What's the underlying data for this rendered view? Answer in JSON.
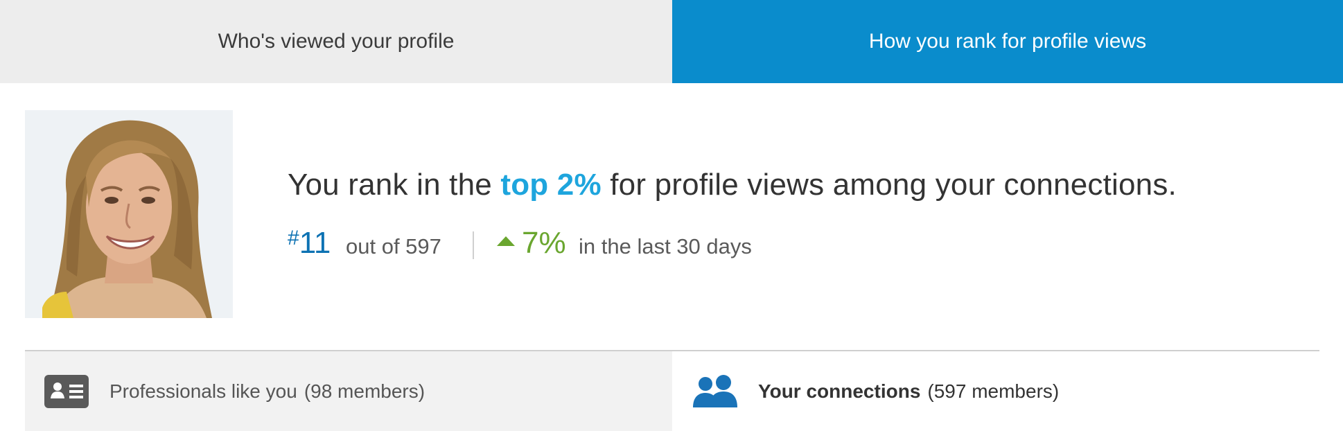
{
  "tabs": [
    {
      "label": "Who's viewed your profile",
      "active": false
    },
    {
      "label": "How you rank for profile views",
      "active": true
    }
  ],
  "rank": {
    "headline_before": "You rank in the",
    "headline_highlight": "top 2%",
    "headline_after": "for profile views among your connections.",
    "position_hash": "#",
    "position_number": "11",
    "position_text": "out of 597",
    "change_percent": "7%",
    "change_period": "in the last 30 days"
  },
  "groups": [
    {
      "label": "Professionals like you",
      "count": "(98 members)",
      "icon": "profile-card-icon"
    },
    {
      "label": "Your connections",
      "count": "(597 members)",
      "icon": "people-icon"
    }
  ],
  "colors": {
    "active_tab": "#0a8ccc",
    "highlight": "#1ea5dd",
    "rank_number": "#0d72b3",
    "positive_change": "#6aa62f"
  }
}
